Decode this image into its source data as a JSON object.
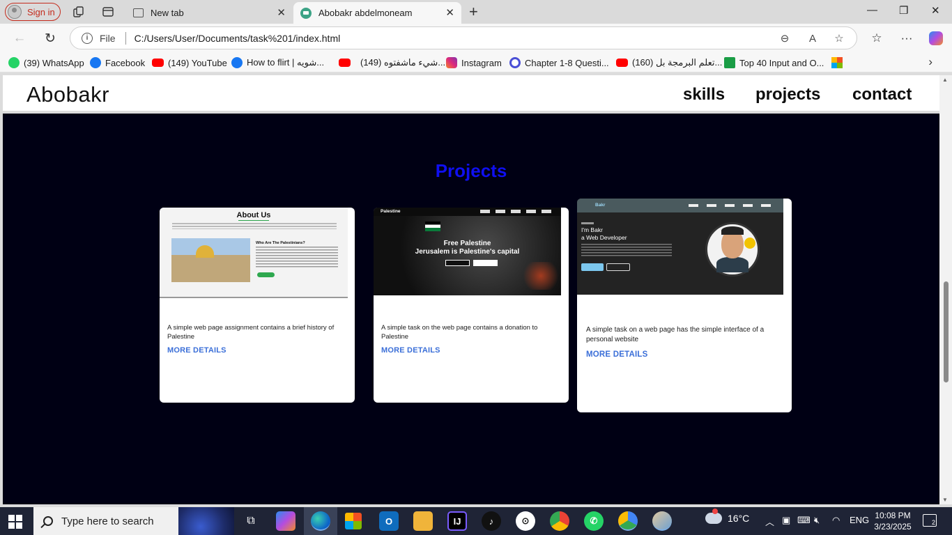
{
  "browser": {
    "signin_label": "Sign in",
    "tabs": [
      {
        "label": "New tab"
      },
      {
        "label": "Abobakr abdelmoneam"
      }
    ],
    "address": {
      "file_label": "File",
      "url": "C:/Users/User/Documents/task%201/index.html"
    },
    "favorites": [
      {
        "label": "(39) WhatsApp",
        "icon": "whatsapp-icon"
      },
      {
        "label": "Facebook",
        "icon": "facebook-icon"
      },
      {
        "label": "(149) YouTube",
        "icon": "youtube-icon"
      },
      {
        "label": "How to flirt | شويه...",
        "icon": "facebook-icon"
      },
      {
        "label": "(149) شيء ماشفتوه...",
        "icon": "youtube-icon"
      },
      {
        "label": "Instagram",
        "icon": "instagram-icon"
      },
      {
        "label": "Chapter 1-8 Questi...",
        "icon": "quizlet-icon"
      },
      {
        "label": "(160) تعلم البرمجة بل...",
        "icon": "youtube-icon"
      },
      {
        "label": "Top 40 Input and O...",
        "icon": "site-icon"
      },
      {
        "label": "",
        "icon": "microsoft-icon"
      }
    ]
  },
  "site": {
    "brand": "Abobakr",
    "nav": [
      {
        "label": "skills"
      },
      {
        "label": "projects"
      },
      {
        "label": "contact"
      }
    ],
    "section_title": "Projects",
    "section_title_color": "#0f0ff0",
    "background_color": "#000014",
    "link_color": "#3b6fd8",
    "projects": [
      {
        "description": "A simple web page assignment contains a brief history of Palestine",
        "more_label": "MORE DETAILS",
        "thumb": {
          "heading": "About Us",
          "subheading": "Who Are The Palestinians?"
        }
      },
      {
        "description": "A simple task on the web page contains a donation to Palestine",
        "more_label": "MORE DETAILS",
        "thumb": {
          "logo": "Palestine",
          "line1": "Free Palestine",
          "line2": "Jerusalem is Palestine's capital"
        }
      },
      {
        "description": "A simple task on a web page has the simple interface of a personal website",
        "more_label": "MORE DETAILS",
        "thumb": {
          "logo": "Bakr",
          "line1": "I'm Bakr",
          "line2": "a Web Developer"
        }
      }
    ]
  },
  "taskbar": {
    "search_placeholder": "Type here to search",
    "weather": "16°C",
    "language": "ENG",
    "time": "10:08 PM",
    "date": "3/23/2025",
    "notifications": "2"
  }
}
